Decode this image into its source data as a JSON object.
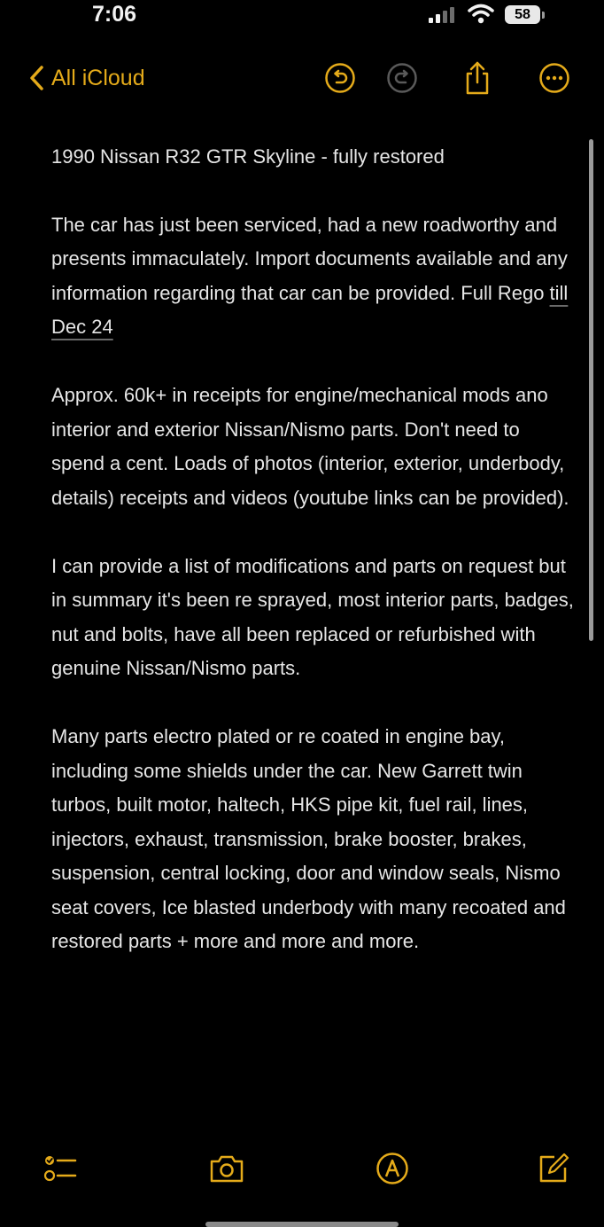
{
  "status_bar": {
    "time": "7:06",
    "battery": "58"
  },
  "nav": {
    "back_label": "All iCloud",
    "accent_color": "#e5ab1a"
  },
  "note": {
    "title": "1990 Nissan R32 GTR Skyline - fully restored",
    "p1_main": "The car has just been serviced, had a new roadworthy and presents immaculately. Import documents available and any information regarding that car can be provided. Full Rego ",
    "p1_date": "till Dec 24",
    "p2": "Approx. 60k+ in receipts for engine/mechanical mods ano interior and exterior Nissan/Nismo parts. Don't need to spend a cent. Loads of photos (interior, exterior, underbody, details) receipts and videos (youtube links can be provided).",
    "p3": "I can provide a list of modifications and parts on request but in summary it's been re sprayed, most interior parts, badges, nut and bolts, have all been replaced or refurbished with genuine Nissan/Nismo parts.",
    "p4": "Many parts electro plated or re coated in engine bay, including some shields under the car. New Garrett twin turbos, built motor, haltech, HKS pipe kit, fuel rail, lines, injectors, exhaust, transmission, brake booster, brakes, suspension, central locking, door and window seals, Nismo seat covers, Ice blasted underbody with many recoated and restored parts + more and more and more."
  },
  "icons": {
    "back": "chevron-left-icon",
    "undo": "undo-icon",
    "redo": "redo-icon",
    "share": "share-icon",
    "more": "ellipsis-icon",
    "checklist": "checklist-icon",
    "camera": "camera-icon",
    "markup": "markup-pen-icon",
    "compose": "compose-icon"
  }
}
